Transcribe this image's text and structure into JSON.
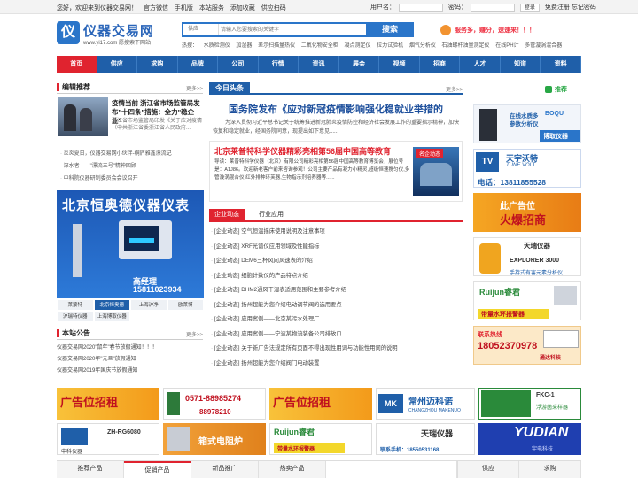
{
  "topbar": {
    "welcome": "您好，欢迎来到仪器交易网！",
    "links": [
      "官方微信",
      "手机版",
      "本站服务",
      "添加收藏",
      "供应扫码"
    ],
    "username_label": "用户名：",
    "password_label": "密码：",
    "login": "登录",
    "register": "免费注册",
    "forgot": "忘记密码"
  },
  "logo": {
    "mark": "仪",
    "name": "仪器交易网",
    "sub": "www.yi17.com 愿搜索下网站"
  },
  "search": {
    "category": "供应",
    "placeholder": "请输入您要搜索的关键字",
    "button": "搜索"
  },
  "slogan": "服务多，赚分，速速来！！！",
  "hotwords": {
    "label": "热搜：",
    "items": [
      "水质检测仪",
      "加湿器",
      "差示扫描量热仪",
      "二氧化物安全柜",
      "凝点测定仪",
      "拉力试验机",
      "烟气分析仪",
      "石油螺杆油量测定仪",
      "在线PH计",
      "多管漩涡混合器"
    ]
  },
  "nav": {
    "items": [
      "首页",
      "供应",
      "求购",
      "品牌",
      "公司",
      "行情",
      "资讯",
      "展会",
      "视频",
      "招商",
      "人才",
      "知道",
      "资料"
    ],
    "active": 0
  },
  "editor": {
    "title": "编辑推荐",
    "more": "更多>>",
    "headline": "疫情当前 浙江省市场监管局发布\"十四条\"措施：全力\"稳企业\"",
    "desc": "浙江省市场监管局印发《关于应对疫情（中共浙江省委浙江省人民政府...",
    "list": [
      "炎炎夏日，仪器交易网小伙伴-桐庐雅鑫漂流记",
      "深水者——\"漂流三号\"精神回顾",
      "中科院仪器研制委员会会议召开"
    ]
  },
  "bigad": {
    "title": "北京恒奥德仪器仪表",
    "phone_label": "高经理",
    "phone": "15811023934"
  },
  "adtabs": {
    "items": [
      "莱蒙特",
      "北京恒奥德",
      "上海沪净",
      "欧莱博",
      "沪瑞特仪器",
      "上海博取仪器"
    ],
    "active": 1
  },
  "notice": {
    "title": "本站公告",
    "more": "更多>>",
    "list": [
      "仪器交易网2020\"鼠年\"春节放假通知！！！",
      "仪器交易网2020年\"元旦\"放假通知",
      "仪器交易网2019年国庆节放假通知"
    ]
  },
  "today": {
    "label": "今日头条",
    "more": "更多>>",
    "headline": "国务院发布《应对新冠疫情影响强化稳就业举措的",
    "body": "为深入贯彻习近平总书记关于统筹推进新冠肺炎疫情防控和经济社会发展工作的重要指示精神，加快恢复和稳定就业，经国务院同意，现提出如下意见......"
  },
  "feature": {
    "title": "北京莱普特科学仪器精彩亮相第56届中国高等教育",
    "body": "导读：莱普特科学仪器（北京）有限公司精彩亮相第56届中国高等教育博览会，展位号是：A1J86。欢迎新老客户前来咨询参观！公司主要产品有凝力小精灵,超级恒速搅匀仪,多管漩涡混合仪,红外排种环芙器,生物指示剂培养器等......",
    "image_tag": "名企动态"
  },
  "newstabs": {
    "items": [
      "企业动态",
      "行业应用"
    ],
    "active": 0
  },
  "news": [
    "[企业动态] 空气恒温摇床使用说明及注意事项",
    "[企业动态] XRF光谱仪应用领域及性能指标",
    "[企业动态] DEM6三杯风向风速表的介绍",
    "[企业动态] 细胞计数仪的产品特点介绍",
    "[企业动态] DHM2通风干湿表适用范围和主要参考介绍",
    "[企业动态] 扬州超能为您介绍电动调节阀的选用要点",
    "[企业动态] 应用案例——北京某污水处理厂",
    "[企业动态] 应用案例——宁波某物流装备公司排放口",
    "[企业动态] 关于新广告法规定所有页面不得出现性用词与功能性用词的说明",
    "[企业动态] 扬州超能为您介绍阀门电动装置"
  ],
  "right": {
    "title": "推荐",
    "ads": [
      {
        "l1": "在线水质多",
        "l2": "参数分析仪",
        "l3": "博取仪器",
        "brand": "BOQU"
      },
      {
        "l1": "天宇沃特",
        "l2": "TUNE VOLT",
        "l3": "电话：13811855528"
      },
      {
        "l1": "此广告位",
        "l2": "火爆招商"
      },
      {
        "l1": "天瑞仪器",
        "l2": "EXPLORER 3000",
        "l3": "手持式有害元素分析仪"
      },
      {
        "l1": "Ruijun睿君",
        "l2": "带量水环报警器"
      },
      {
        "l1": "联系热线",
        "l2": "18052370978",
        "l3": "通达科技"
      }
    ]
  },
  "banners": {
    "row1": [
      {
        "b1": "广告位招租",
        "b2": ""
      },
      {
        "b1": "0571-88985274",
        "b2": "88978210"
      },
      {
        "b1": "广告位招租",
        "b2": ""
      },
      {
        "b1": "常州迈科诺",
        "b2": "CHANGZHOU MAKENUO"
      },
      {
        "b1": "FKC-1",
        "b2": "浮游菌采样器"
      }
    ],
    "row2": [
      {
        "b1": "中科仪器",
        "b2": "ZH-RG6080"
      },
      {
        "b1": "箱式电阻炉",
        "b2": ""
      },
      {
        "b1": "Ruijun睿君",
        "b2": "带量水环报警器"
      },
      {
        "b1": "天瑞仪器",
        "b2": "联系手机：18550531168"
      },
      {
        "b1": "YUDIAN",
        "b2": "宇电科技"
      }
    ]
  },
  "btabs": {
    "items": [
      "推荐产品",
      "促销产品",
      "新品推广",
      "热卖产品",
      "供应",
      "求购"
    ],
    "active": 1
  },
  "colors": {
    "nav": "#1f5fa9",
    "accent": "#e0232f",
    "link_blue": "#1d4f9c"
  }
}
